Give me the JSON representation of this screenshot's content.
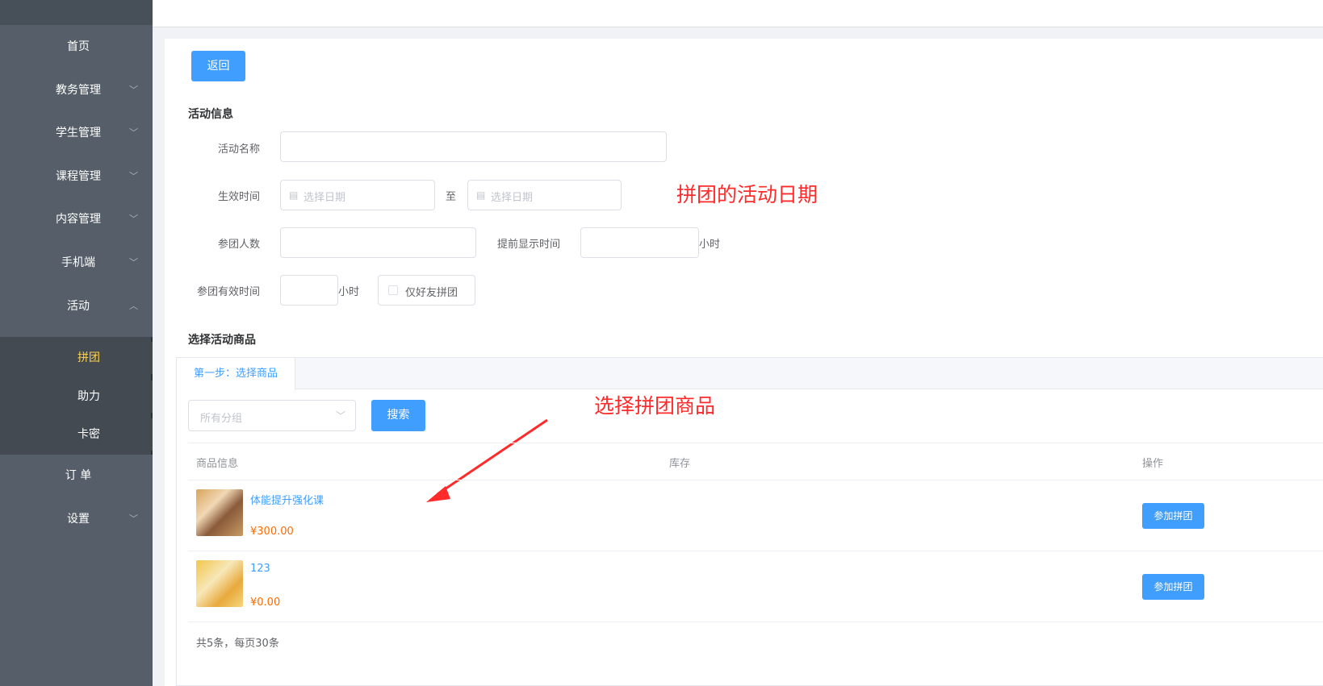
{
  "sidebar": {
    "items": [
      {
        "label": "首页"
      },
      {
        "label": "教务管理"
      },
      {
        "label": "学生管理"
      },
      {
        "label": "课程管理"
      },
      {
        "label": "内容管理"
      },
      {
        "label": "手机端"
      },
      {
        "label": "活动"
      },
      {
        "label": "订 单"
      },
      {
        "label": "设置"
      }
    ],
    "subitems": [
      {
        "label": "拼团"
      },
      {
        "label": "助力"
      },
      {
        "label": "卡密"
      }
    ]
  },
  "toolbar": {
    "back_label": "返回"
  },
  "activity_info": {
    "title": "活动信息",
    "name_label": "活动名称",
    "time_label": "生效时间",
    "start_placeholder": "选择日期",
    "to_label": "至",
    "end_placeholder": "选择日期",
    "members_label": "参团人数",
    "advance_label": "提前显示时间",
    "advance_unit": "小时",
    "valid_label": "参团有效时间",
    "valid_unit": "小时",
    "friends_only_label": "仅好友拼团"
  },
  "products": {
    "title": "选择活动商品",
    "tab_label": "第一步：选择商品",
    "group_placeholder": "所有分组",
    "search_label": "搜索",
    "columns": [
      "商品信息",
      "库存",
      "操作"
    ],
    "rows": [
      {
        "name": "体能提升强化课",
        "price": "¥300.00",
        "action": "参加拼团"
      },
      {
        "name": "123",
        "price": "¥0.00",
        "action": "参加拼团"
      }
    ],
    "footer": "共5条，每页30条"
  },
  "annotations": {
    "date_note": "拼团的活动日期",
    "product_note": "选择拼团商品"
  },
  "colors": {
    "primary": "#409eff",
    "sidebar": "#565f69",
    "annotation": "#ff2a2a",
    "price": "#ff6a00"
  }
}
